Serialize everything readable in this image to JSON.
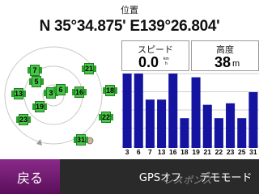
{
  "position": {
    "title": "位置",
    "coordinates": "N 35°34.875' E139°26.804'"
  },
  "speed": {
    "label": "スピード",
    "value": "0.0",
    "unit": "km/h"
  },
  "altitude": {
    "label": "高度",
    "value": "38",
    "unit": "m"
  },
  "satellites": [
    "7",
    "21",
    "5",
    "3",
    "6",
    "16",
    "18",
    "13",
    "19",
    "22",
    "23",
    "31"
  ],
  "signal_chart": {
    "labels": [
      "3",
      "6",
      "7",
      "13",
      "16",
      "18",
      "19",
      "21",
      "22",
      "23",
      "25",
      "31"
    ],
    "levels": [
      1.0,
      1.0,
      0.65,
      0.65,
      1.0,
      0.4,
      0.95,
      0.58,
      0.4,
      0.6,
      0.4,
      0.75
    ],
    "bar_color": "#1414a0",
    "grid": true
  },
  "buttons": {
    "back": "戻る",
    "gps_off": "GPSオフ",
    "demo_mode": "デモモード"
  },
  "watermark": "レスポンス",
  "colors": {
    "satellite": "#48c448",
    "back_button": "#7a1f7a",
    "bar": "#1414a0"
  }
}
